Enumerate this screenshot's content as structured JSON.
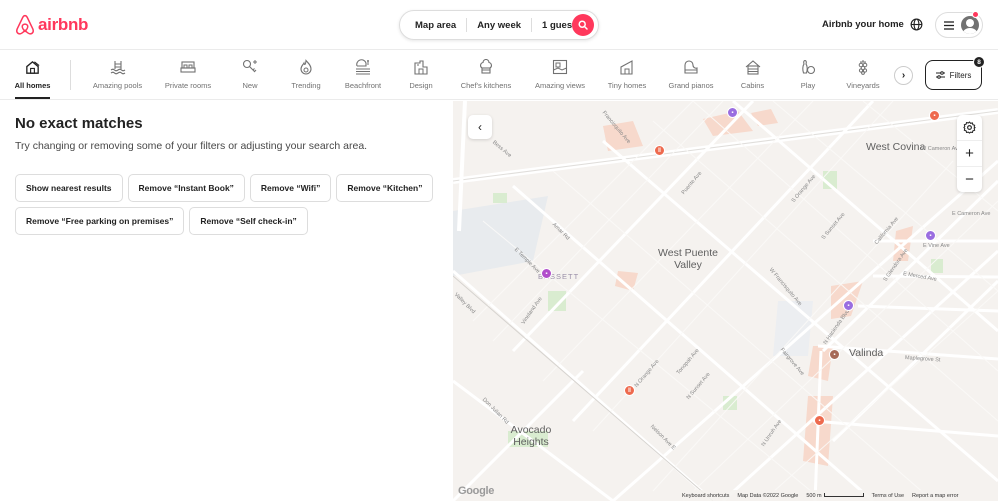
{
  "header": {
    "logo_text": "airbnb",
    "search": {
      "location": "Map area",
      "dates": "Any week",
      "guests": "1 guest"
    },
    "host_link": "Airbnb your home",
    "brand_color": "#ff385c"
  },
  "categories": {
    "items": [
      {
        "label": "All homes",
        "icon": "house-stack-icon",
        "active": true
      },
      {
        "label": "Amazing pools",
        "icon": "pool-icon",
        "active": false
      },
      {
        "label": "Private rooms",
        "icon": "bed-icon",
        "active": false
      },
      {
        "label": "New",
        "icon": "key-sparkle-icon",
        "active": false
      },
      {
        "label": "Trending",
        "icon": "flame-icon",
        "active": false
      },
      {
        "label": "Beachfront",
        "icon": "beach-umbrella-icon",
        "active": false
      },
      {
        "label": "Design",
        "icon": "design-building-icon",
        "active": false
      },
      {
        "label": "Chef's kitchens",
        "icon": "chef-hat-icon",
        "active": false
      },
      {
        "label": "Amazing views",
        "icon": "landscape-frame-icon",
        "active": false
      },
      {
        "label": "Tiny homes",
        "icon": "tiny-home-icon",
        "active": false
      },
      {
        "label": "Grand pianos",
        "icon": "piano-icon",
        "active": false
      },
      {
        "label": "Cabins",
        "icon": "cabin-icon",
        "active": false
      },
      {
        "label": "Play",
        "icon": "bowling-icon",
        "active": false
      },
      {
        "label": "Vineyards",
        "icon": "grapes-icon",
        "active": false
      }
    ],
    "filters_label": "Filters",
    "filters_count": "8"
  },
  "results": {
    "title": "No exact matches",
    "subtitle": "Try changing or removing some of your filters or adjusting your search area.",
    "suggestions": [
      "Show nearest results",
      "Remove “Instant Book”",
      "Remove “Wifi”",
      "Remove “Kitchen”",
      "Remove “Free parking on premises”",
      "Remove “Self check-in”"
    ]
  },
  "map": {
    "places": [
      "West Covina",
      "West Puente Valley",
      "BASSETT",
      "Valinda",
      "Avocado Heights"
    ],
    "streets": [
      "Francisquito Ave",
      "Bess Ave",
      "Puente Ave",
      "Amar Rd",
      "E Temple Ave",
      "S Orange Ave",
      "S Sunset Ave",
      "California Ave",
      "E Vine Ave",
      "E Merced Ave",
      "W Francisquito Ave",
      "N Hacienda Blvd",
      "Maplegrove St",
      "Fairgrove Ave",
      "Valley Blvd",
      "Vineland Ave",
      "N Orange Ave",
      "Tonopah Ave",
      "N Sunset Ave",
      "Nelson Ave E",
      "Don Julian Rd",
      "N Unruh Ave",
      "S Glendora Ave",
      "E Cameron Ave",
      "W Cameron Ave"
    ],
    "google_logo": "Google",
    "attribution": {
      "shortcuts": "Keyboard shortcuts",
      "data": "Map Data ©2022 Google",
      "scale": "500 m",
      "terms": "Terms of Use",
      "report": "Report a map error"
    }
  }
}
